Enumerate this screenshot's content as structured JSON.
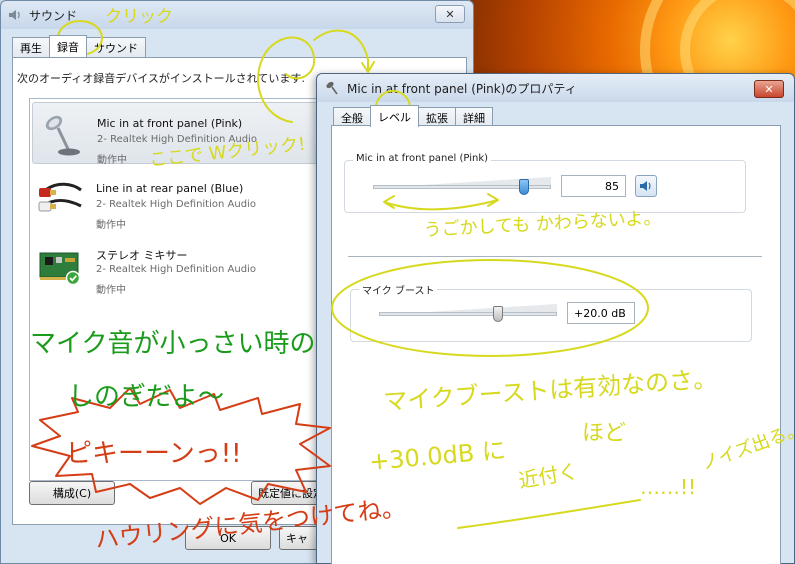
{
  "sound_window": {
    "title": "サウンド",
    "close_label": "✕",
    "tabs": [
      {
        "label": "再生"
      },
      {
        "label": "録音",
        "active": true
      },
      {
        "label": "サウンド"
      }
    ],
    "instruction": "次のオーディオ録音デバイスがインストールされています:",
    "devices": [
      {
        "name": "Mic in at front panel (Pink)",
        "driver": "2- Realtek High Definition Audio",
        "status": "動作中",
        "icon": "microphone-icon",
        "selected": true
      },
      {
        "name": "Line in at rear panel (Blue)",
        "driver": "2- Realtek High Definition Audio",
        "status": "動作中",
        "icon": "audio-cable-icon"
      },
      {
        "name": "ステレオ ミキサー",
        "driver": "2- Realtek High Definition Audio",
        "status": "動作中",
        "icon": "sound-card-icon",
        "default": true
      }
    ],
    "buttons": {
      "configure": "構成(C)",
      "set_default": "既定値に設定",
      "ok": "OK",
      "cancel": "キャ"
    }
  },
  "prop_window": {
    "title": "Mic in at front panel (Pink)のプロパティ",
    "close_label": "✕",
    "tabs": [
      {
        "label": "全般"
      },
      {
        "label": "レベル",
        "active": true
      },
      {
        "label": "拡張"
      },
      {
        "label": "詳細"
      }
    ],
    "level": {
      "label": "Mic in at front panel (Pink)",
      "value": "85",
      "value_fraction": 0.85
    },
    "boost": {
      "label": "マイク ブースト",
      "value": "+20.0 dB",
      "value_fraction": 0.6667
    }
  },
  "annotations": {
    "click_note": "クリック",
    "double_click_note": "ここで Wクリック!",
    "no_change_note": "うごかしても かわらないよ。",
    "green_note_1": "マイク音が小っさい時の",
    "green_note_2": "しのぎだよ〜",
    "boost_effective": "マイクブーストは有効なのさ。",
    "boost_value": "+30.0dB に",
    "boost_value_tail": "ほど",
    "near_note": "近付く",
    "noise_note": "ノイズ出る。",
    "noise_dots": "……!!",
    "red_shout": "ピキーーンっ!!",
    "red_note": "ハウリングに気をつけてね。"
  },
  "colors": {
    "annotation_yellow": "#d7d91e",
    "annotation_green": "#1b9b1b",
    "annotation_red": "#d53d16",
    "thumb_blue": "#5aa6e6"
  }
}
